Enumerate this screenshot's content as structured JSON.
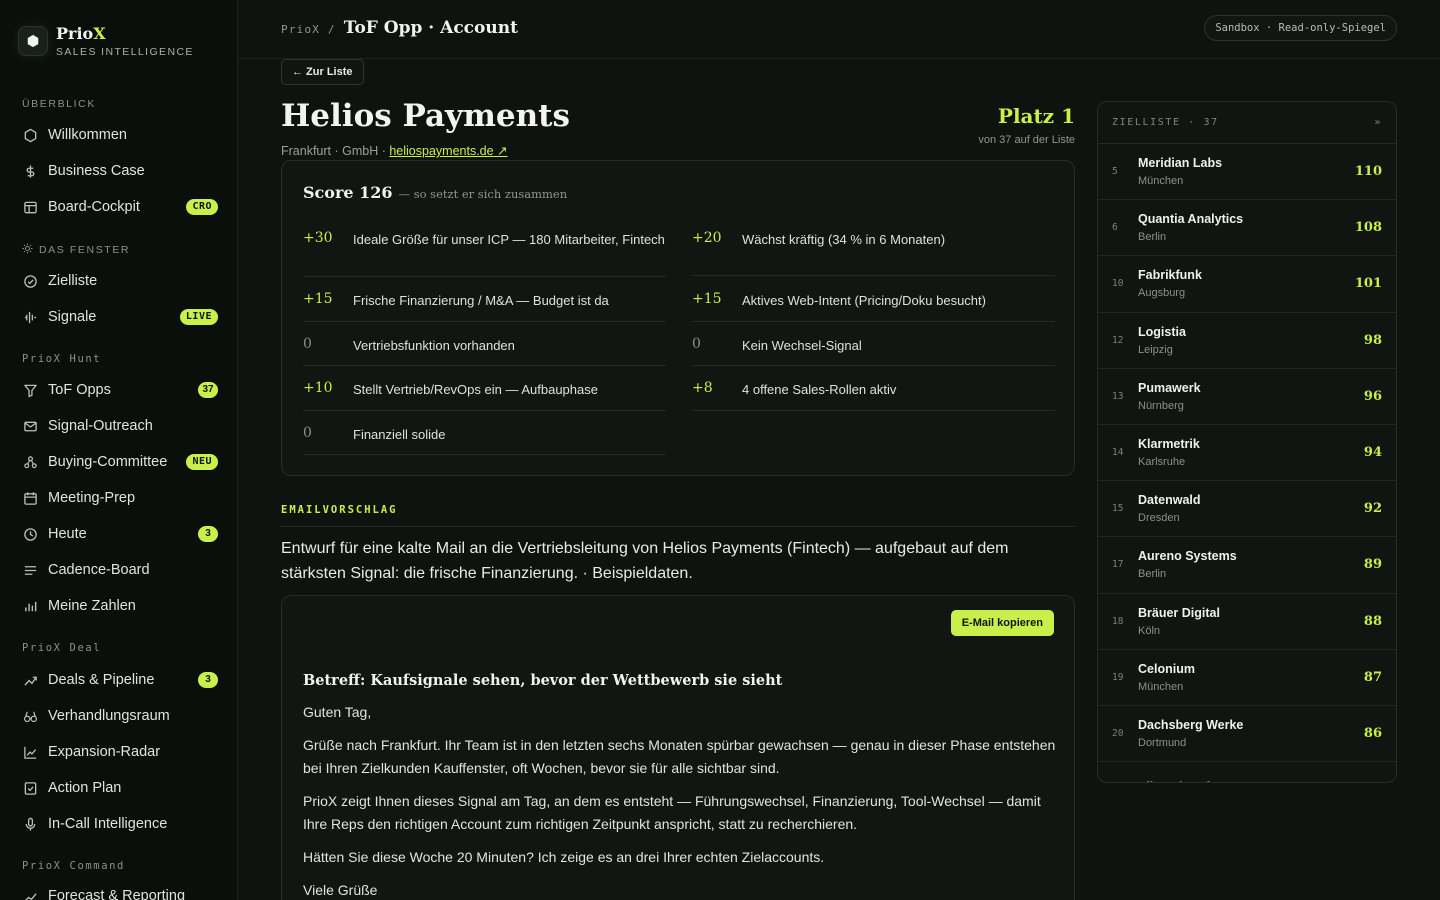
{
  "brand": {
    "name_main": "Prio",
    "name_accent": "X",
    "subtitle": "SALES INTELLIGENCE"
  },
  "sidebar": {
    "sections": [
      {
        "label": "ÜBERBLICK"
      },
      {
        "label": "DAS FENSTER"
      },
      {
        "label": "PrioX Hunt"
      },
      {
        "label": "PrioX Deal"
      },
      {
        "label": "PrioX Command"
      }
    ],
    "items": [
      {
        "label": "Willkommen",
        "icon": "hexagon-icon"
      },
      {
        "label": "Business Case",
        "icon": "dollar-icon"
      },
      {
        "label": "Board-Cockpit",
        "icon": "board-icon",
        "badge": "CRO"
      },
      {
        "label": "Zielliste",
        "icon": "target-icon"
      },
      {
        "label": "Signale",
        "icon": "signal-icon",
        "badge": "LIVE"
      },
      {
        "label": "ToF Opps",
        "icon": "funnel-icon",
        "badge": "37"
      },
      {
        "label": "Signal-Outreach",
        "icon": "mail-icon"
      },
      {
        "label": "Buying-Committee",
        "icon": "people-icon",
        "badge": "NEU"
      },
      {
        "label": "Meeting-Prep",
        "icon": "calendar-icon"
      },
      {
        "label": "Heute",
        "icon": "clock-icon",
        "badge": "3"
      },
      {
        "label": "Cadence-Board",
        "icon": "lines-icon"
      },
      {
        "label": "Meine Zahlen",
        "icon": "bars-icon"
      },
      {
        "label": "Deals & Pipeline",
        "icon": "trend-icon",
        "badge": "3"
      },
      {
        "label": "Verhandlungsraum",
        "icon": "binoculars-icon"
      },
      {
        "label": "Expansion-Radar",
        "icon": "chart-up-icon"
      },
      {
        "label": "Action Plan",
        "icon": "checklist-icon"
      },
      {
        "label": "In-Call Intelligence",
        "icon": "mic-icon"
      },
      {
        "label": "Forecast & Reporting",
        "icon": "forecast-icon"
      }
    ]
  },
  "header": {
    "crumb_root": "PrioX /",
    "title": "ToF Opp · Account",
    "env": "Sandbox · Read-only-Spiegel"
  },
  "account": {
    "back_label": "← Zur Liste",
    "name": "Helios Payments",
    "meta_prefix": "Frankfurt · GmbH · ",
    "website": "heliospayments.de ↗",
    "rank_label": "Platz 1",
    "rank_sub": "von 37 auf der Liste"
  },
  "score": {
    "title": "Score 126",
    "subtitle": "— so setzt er sich zusammen",
    "left": [
      {
        "pts": "+30",
        "desc": "Ideale Größe für unser ICP — 180 Mitarbeiter, Fintech"
      },
      {
        "pts": "+15",
        "desc": "Frische Finanzierung / M&A — Budget ist da"
      },
      {
        "pts": "0",
        "desc": "Vertriebsfunktion vorhanden"
      },
      {
        "pts": "+10",
        "desc": "Stellt Vertrieb/RevOps ein — Aufbauphase"
      },
      {
        "pts": "0",
        "desc": "Finanziell solide"
      }
    ],
    "right": [
      {
        "pts": "+20",
        "desc": "Wächst kräftig (34 % in 6 Monaten)"
      },
      {
        "pts": "+15",
        "desc": "Aktives Web-Intent (Pricing/Doku besucht)"
      },
      {
        "pts": "0",
        "desc": "Kein Wechsel-Signal"
      },
      {
        "pts": "+8",
        "desc": "4 offene Sales-Rollen aktiv"
      }
    ]
  },
  "email": {
    "section_label": "EMAILVORSCHLAG",
    "intro": "Entwurf für eine kalte Mail an die Vertriebsleitung von Helios Payments (Fintech) — aufgebaut auf dem stärksten Signal: die frische Finanzierung. · Beispieldaten.",
    "copy_label": "E-Mail kopieren",
    "subject": "Betreff: Kaufsignale sehen, bevor der Wettbewerb sie sieht",
    "greeting": "Guten Tag,",
    "p1": "Grüße nach Frankfurt. Ihr Team ist in den letzten sechs Monaten spürbar gewachsen — genau in dieser Phase entstehen bei Ihren Zielkunden Kauffenster, oft Wochen, bevor sie für alle sichtbar sind.",
    "p2": "PrioX zeigt Ihnen dieses Signal am Tag, an dem es entsteht — Führungswechsel, Finanzierung, Tool-Wechsel — damit Ihre Reps den richtigen Account zum richtigen Zeitpunkt anspricht, statt zu recherchieren.",
    "p3": "Hätten Sie diese Woche 20 Minuten? Ich zeige es an drei Ihrer echten Zielaccounts.",
    "closing": "Viele Grüße"
  },
  "target_list": {
    "header": "ZIELLISTE · 37",
    "chevron": "»",
    "rows": [
      {
        "num": "5",
        "name": "Meridian Labs",
        "city": "München",
        "score": "110"
      },
      {
        "num": "6",
        "name": "Quantia Analytics",
        "city": "Berlin",
        "score": "108"
      },
      {
        "num": "10",
        "name": "Fabrikfunk",
        "city": "Augsburg",
        "score": "101"
      },
      {
        "num": "12",
        "name": "Logistia",
        "city": "Leipzig",
        "score": "98"
      },
      {
        "num": "13",
        "name": "Pumawerk",
        "city": "Nürnberg",
        "score": "96"
      },
      {
        "num": "14",
        "name": "Klarmetrik",
        "city": "Karlsruhe",
        "score": "94"
      },
      {
        "num": "15",
        "name": "Datenwald",
        "city": "Dresden",
        "score": "92"
      },
      {
        "num": "17",
        "name": "Aureno Systems",
        "city": "Berlin",
        "score": "89"
      },
      {
        "num": "18",
        "name": "Bräuer Digital",
        "city": "Köln",
        "score": "88"
      },
      {
        "num": "19",
        "name": "Celonium",
        "city": "München",
        "score": "87"
      },
      {
        "num": "20",
        "name": "Dachsberg Werke",
        "city": "Dortmund",
        "score": "86"
      },
      {
        "num": "",
        "name": "Elbwerk Software",
        "city": "",
        "score": ""
      }
    ]
  },
  "colors": {
    "accent": "#c8ef4a",
    "background": "#0e130f",
    "sidebar": "#0b0f0c",
    "card": "#111612"
  }
}
